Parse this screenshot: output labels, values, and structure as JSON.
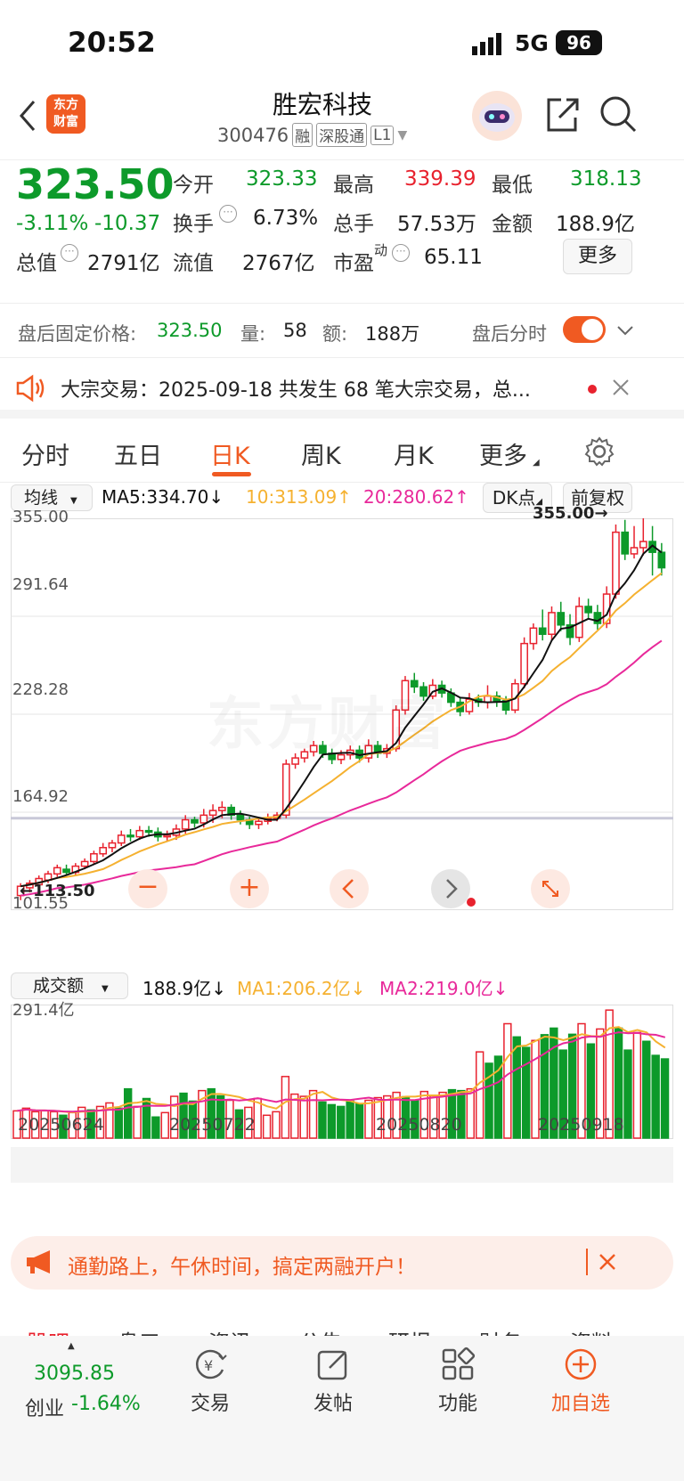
{
  "status_bar": {
    "time": "20:52",
    "network": "5G",
    "battery": "96"
  },
  "header": {
    "title": "胜宏科技",
    "code": "300476",
    "tags": [
      "融",
      "深股通",
      "L1"
    ],
    "logo_text_1": "东方",
    "logo_text_2": "财富"
  },
  "quote": {
    "price": "323.50",
    "change_pct": "-3.11%",
    "change": "-10.37",
    "open_label": "今开",
    "open": "323.33",
    "high_label": "最高",
    "high": "339.39",
    "low_label": "最低",
    "low": "318.13",
    "turnover_label": "换手",
    "turnover": "6.73%",
    "volume_label": "总手",
    "volume": "57.53万",
    "amount_label": "金额",
    "amount": "188.9亿",
    "mktcap_label": "总值",
    "mktcap": "2791亿",
    "float_label": "流值",
    "float_cap": "2767亿",
    "pe_label": "市盈",
    "pe_sup": "动",
    "pe": "65.11",
    "more_button": "更多"
  },
  "after_hours": {
    "price_label": "盘后固定价格:",
    "price": "323.50",
    "vol_label": "量:",
    "vol": "58",
    "amt_label": "额:",
    "amt": "188万",
    "toggle_label": "盘后分时",
    "toggle_on": true
  },
  "block_trade": {
    "text": "大宗交易：2025-09-18 共发生 68 笔大宗交易，总..."
  },
  "tabs": [
    "分时",
    "五日",
    "日K",
    "周K",
    "月K",
    "更多"
  ],
  "active_tab": "日K",
  "ma_bar": {
    "selector": "均线",
    "ma5": "MA5:334.70",
    "ma10": "10:313.09",
    "ma20": "20:280.62",
    "dk": "DK点",
    "adjust": "前复权"
  },
  "kchart_labels": {
    "y_ticks": [
      "355.00",
      "291.64",
      "228.28",
      "164.92",
      "101.55"
    ],
    "high_marker": "355.00",
    "low_marker": "113.50",
    "watermark": "东方财富"
  },
  "vol_bar": {
    "selector": "成交额",
    "value": "188.9亿",
    "ma1": "MA1:206.2亿",
    "ma2": "MA2:219.0亿"
  },
  "vol_labels": {
    "y_top": "291.4亿",
    "x_ticks": [
      "20250624",
      "20250722",
      "20250820",
      "20250918"
    ]
  },
  "promo": {
    "text": "通勤路上，午休时间，搞定两融开户！"
  },
  "sub_tabs": [
    "股吧",
    "盘口",
    "资讯",
    "公告",
    "研报",
    "财务",
    "资料"
  ],
  "bottom_nav": {
    "index_value": "3095.85",
    "index_name": "创业",
    "index_change": "-1.64%",
    "items": [
      "交易",
      "发帖",
      "功能",
      "加自选"
    ]
  },
  "colors": {
    "up": "#e8222e",
    "down": "#0d9a2a",
    "accent": "#f05a22",
    "ma5": "#111111",
    "ma10": "#f5b130",
    "ma20": "#e8299a"
  },
  "chart_data": {
    "type": "candlestick",
    "ylim": [
      101.55,
      355.0
    ],
    "candles": [
      [
        111,
        117,
        108,
        119
      ],
      [
        116,
        119,
        113,
        121
      ],
      [
        118,
        122,
        116,
        124
      ],
      [
        121,
        125,
        119,
        127
      ],
      [
        125,
        129,
        123,
        131
      ],
      [
        128,
        126,
        124,
        131
      ],
      [
        126,
        130,
        124,
        132
      ],
      [
        130,
        133,
        128,
        135
      ],
      [
        133,
        138,
        131,
        140
      ],
      [
        138,
        142,
        136,
        145
      ],
      [
        142,
        145,
        139,
        147
      ],
      [
        145,
        150,
        143,
        153
      ],
      [
        150,
        149,
        146,
        154
      ],
      [
        149,
        153,
        147,
        156
      ],
      [
        153,
        152,
        149,
        156
      ],
      [
        152,
        149,
        146,
        155
      ],
      [
        149,
        150,
        146,
        153
      ],
      [
        150,
        154,
        147,
        157
      ],
      [
        154,
        160,
        151,
        163
      ],
      [
        160,
        158,
        155,
        162
      ],
      [
        158,
        163,
        155,
        167
      ],
      [
        163,
        166,
        158,
        170
      ],
      [
        166,
        168,
        161,
        172
      ],
      [
        168,
        163,
        160,
        170
      ],
      [
        163,
        160,
        157,
        166
      ],
      [
        160,
        157,
        154,
        162
      ],
      [
        157,
        159,
        154,
        162
      ],
      [
        159,
        161,
        157,
        164
      ],
      [
        161,
        163,
        159,
        165
      ],
      [
        163,
        196,
        161,
        199
      ],
      [
        196,
        200,
        193,
        203
      ],
      [
        200,
        204,
        197,
        206
      ],
      [
        204,
        208,
        201,
        211
      ],
      [
        208,
        203,
        200,
        211
      ],
      [
        203,
        199,
        196,
        206
      ],
      [
        199,
        202,
        196,
        205
      ],
      [
        202,
        205,
        199,
        208
      ],
      [
        205,
        200,
        197,
        208
      ],
      [
        200,
        208,
        197,
        212
      ],
      [
        208,
        203,
        200,
        211
      ],
      [
        203,
        206,
        200,
        209
      ],
      [
        206,
        231,
        204,
        234
      ],
      [
        231,
        250,
        228,
        253
      ],
      [
        250,
        246,
        242,
        255
      ],
      [
        246,
        240,
        237,
        249
      ],
      [
        240,
        247,
        238,
        251
      ],
      [
        247,
        242,
        239,
        250
      ],
      [
        242,
        236,
        233,
        245
      ],
      [
        236,
        230,
        227,
        239
      ],
      [
        230,
        238,
        228,
        242
      ],
      [
        238,
        236,
        233,
        241
      ],
      [
        236,
        240,
        232,
        247
      ],
      [
        240,
        237,
        233,
        243
      ],
      [
        237,
        231,
        228,
        240
      ],
      [
        231,
        248,
        229,
        251
      ],
      [
        248,
        274,
        245,
        278
      ],
      [
        274,
        284,
        270,
        287
      ],
      [
        284,
        280,
        276,
        296
      ],
      [
        280,
        294,
        276,
        298
      ],
      [
        294,
        286,
        282,
        301
      ],
      [
        286,
        278,
        273,
        293
      ],
      [
        278,
        298,
        275,
        304
      ],
      [
        298,
        294,
        290,
        303
      ],
      [
        294,
        287,
        283,
        299
      ],
      [
        287,
        306,
        284,
        311
      ],
      [
        306,
        346,
        303,
        351
      ],
      [
        346,
        332,
        328,
        354
      ],
      [
        332,
        336,
        329,
        350
      ],
      [
        336,
        340,
        331,
        355
      ],
      [
        340,
        333,
        318,
        350
      ],
      [
        333,
        323,
        318,
        339
      ]
    ],
    "ma5_label": "MA5",
    "ma10_label": "10",
    "ma20_label": "20",
    "volume": [
      [
        62,
        1
      ],
      [
        68,
        1
      ],
      [
        60,
        1
      ],
      [
        62,
        1
      ],
      [
        60,
        1
      ],
      [
        52,
        0
      ],
      [
        58,
        1
      ],
      [
        70,
        1
      ],
      [
        64,
        0
      ],
      [
        72,
        1
      ],
      [
        80,
        1
      ],
      [
        68,
        0
      ],
      [
        112,
        0
      ],
      [
        72,
        1
      ],
      [
        90,
        0
      ],
      [
        48,
        0
      ],
      [
        58,
        1
      ],
      [
        95,
        1
      ],
      [
        102,
        0
      ],
      [
        84,
        0
      ],
      [
        108,
        1
      ],
      [
        112,
        0
      ],
      [
        96,
        0
      ],
      [
        86,
        1
      ],
      [
        64,
        0
      ],
      [
        70,
        1
      ],
      [
        90,
        1
      ],
      [
        52,
        1
      ],
      [
        60,
        1
      ],
      [
        140,
        1
      ],
      [
        100,
        1
      ],
      [
        95,
        1
      ],
      [
        108,
        1
      ],
      [
        82,
        0
      ],
      [
        76,
        0
      ],
      [
        72,
        0
      ],
      [
        84,
        0
      ],
      [
        78,
        0
      ],
      [
        86,
        1
      ],
      [
        92,
        1
      ],
      [
        96,
        1
      ],
      [
        104,
        1
      ],
      [
        94,
        0
      ],
      [
        86,
        0
      ],
      [
        106,
        1
      ],
      [
        96,
        1
      ],
      [
        104,
        1
      ],
      [
        110,
        0
      ],
      [
        108,
        0
      ],
      [
        112,
        1
      ],
      [
        196,
        1
      ],
      [
        170,
        0
      ],
      [
        186,
        0
      ],
      [
        260,
        1
      ],
      [
        230,
        0
      ],
      [
        206,
        0
      ],
      [
        222,
        1
      ],
      [
        235,
        0
      ],
      [
        250,
        0
      ],
      [
        200,
        0
      ],
      [
        236,
        0
      ],
      [
        260,
        1
      ],
      [
        214,
        0
      ],
      [
        248,
        1
      ],
      [
        291,
        1
      ],
      [
        250,
        0
      ],
      [
        200,
        0
      ],
      [
        240,
        1
      ],
      [
        220,
        0
      ],
      [
        188,
        0
      ],
      [
        180,
        0
      ]
    ],
    "vol_ylim": [
      0,
      291.4
    ]
  }
}
